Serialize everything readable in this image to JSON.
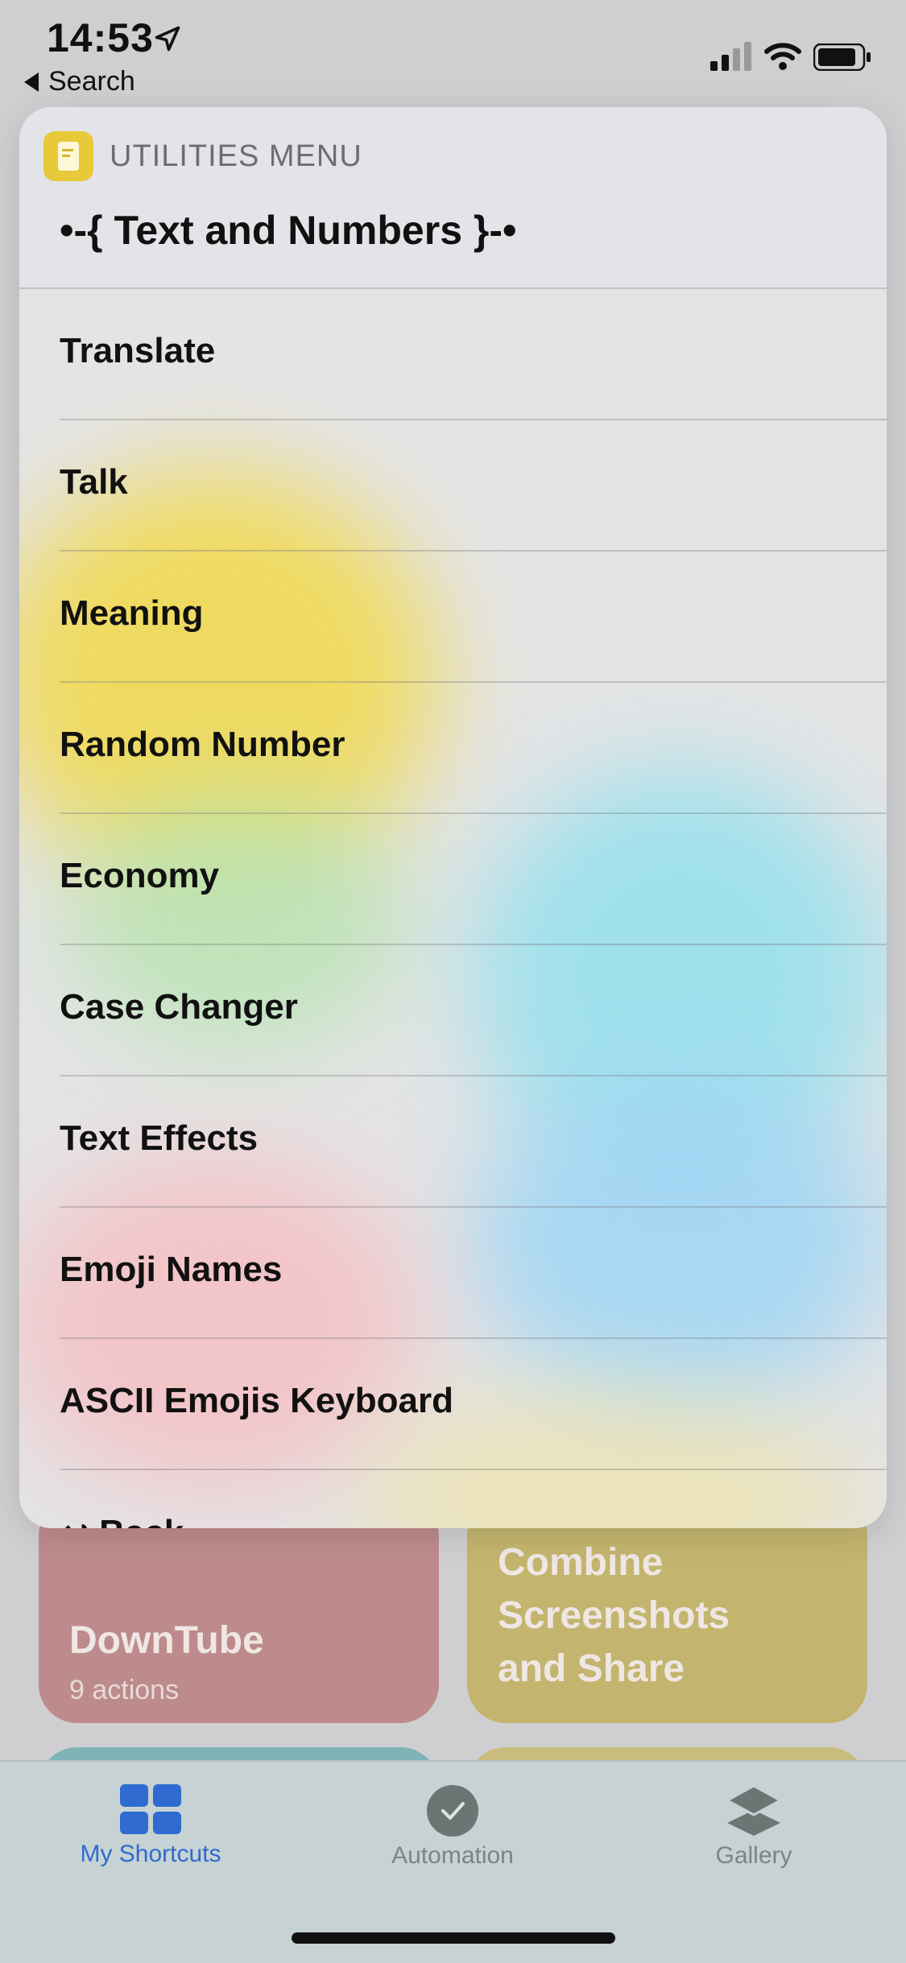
{
  "status_bar": {
    "time": "14:53"
  },
  "nav": {
    "back_label": "Search"
  },
  "menu": {
    "kicker": "UTILITIES MENU",
    "title": "•-{ Text and Numbers }-•",
    "items": [
      {
        "label": "Translate"
      },
      {
        "label": "Talk"
      },
      {
        "label": "Meaning"
      },
      {
        "label": "Random Number"
      },
      {
        "label": "Economy"
      },
      {
        "label": "Case Changer"
      },
      {
        "label": "Text Effects"
      },
      {
        "label": "Emoji Names"
      },
      {
        "label": "ASCII Emojis Keyboard"
      },
      {
        "label": "↩ Back"
      }
    ]
  },
  "tiles": [
    {
      "title": "DownTube",
      "subtitle": "9 actions",
      "color": "#bd8b8b"
    },
    {
      "title": "Combine Screenshots and Share",
      "color": "#c3b56e"
    }
  ],
  "tabbar": {
    "items": [
      {
        "label": "My Shortcuts",
        "icon": "grid-icon",
        "active": true,
        "color": "#2f6bd1"
      },
      {
        "label": "Automation",
        "icon": "check-circle-icon",
        "active": false
      },
      {
        "label": "Gallery",
        "icon": "layers-icon",
        "active": false
      }
    ]
  }
}
